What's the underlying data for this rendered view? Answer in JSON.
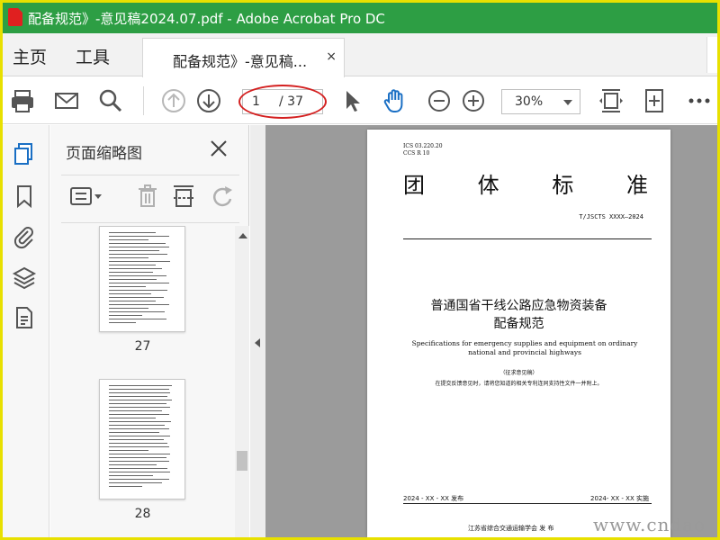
{
  "window": {
    "title": "配备规范》-意见稿2024.07.pdf - Adobe Acrobat Pro DC"
  },
  "nav": {
    "home": "主页",
    "tools": "工具"
  },
  "tab": {
    "label": "配备规范》-意见稿...",
    "close": "×"
  },
  "toolbar": {
    "page_current": "1",
    "page_total": "/ 37",
    "zoom": "30%"
  },
  "panel": {
    "title": "页面缩略图",
    "thumbnails": [
      {
        "page": "27"
      },
      {
        "page": "28"
      }
    ]
  },
  "document": {
    "ics": "ICS  03.220.20",
    "ccs": "CCS R 10",
    "type_chars": [
      "团",
      "体",
      "标",
      "准"
    ],
    "number": "T/JSCTS XXXX—2024",
    "title_line1": "普通国省干线公路应急物资装备",
    "title_line2": "配备规范",
    "title_en": "Specifications for emergency supplies and equipment on ordinary national and provincial highways",
    "draft_note": "（征求意见稿）",
    "submit_note": "在提交反馈意见时，请将您知道的相关专利连同支持性文件一并附上。",
    "publish_date": "2024 - XX - XX 发布",
    "impl_date": "2024- XX - XX 实施",
    "issuer": "江苏省综合交通运输学会    发  布"
  },
  "watermark": "www.cndao",
  "colors": {
    "titlebar": "#2d9e44",
    "frame": "#e8e000",
    "accent_blue": "#1a6fc4",
    "highlight_red": "#d42020"
  }
}
